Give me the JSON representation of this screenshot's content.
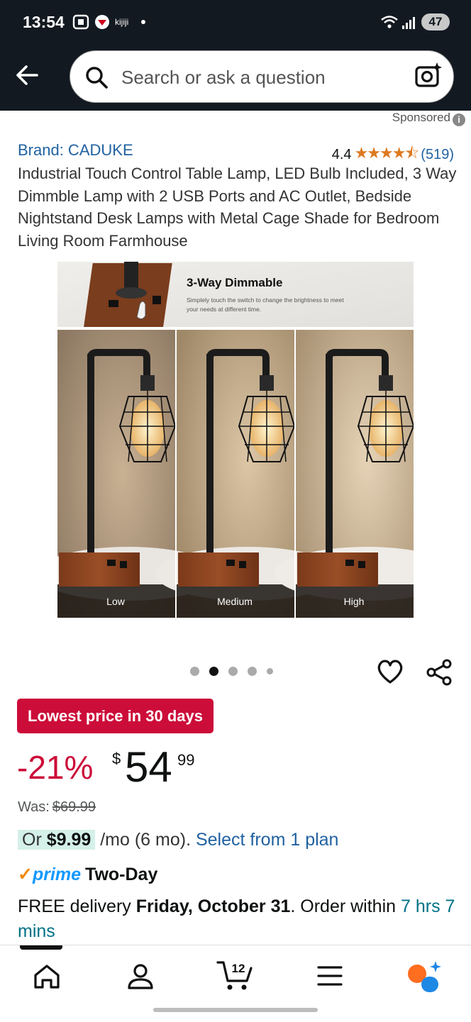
{
  "status": {
    "time": "13:54",
    "app_name": "kijiji",
    "battery": "47"
  },
  "search": {
    "placeholder": "Search or ask a question"
  },
  "sponsored_label": "Sponsored",
  "product": {
    "brand": "Brand: CADUKE",
    "rating_value": "4.4",
    "rating_stars_out_of_5": 4.4,
    "rating_count": "(519)",
    "title": "Industrial Touch Control Table Lamp, LED Bulb Included, 3 Way Dimmble Lamp with 2 USB Ports and AC Outlet, Bedside Nightstand Desk Lamps with Metal Cage Shade for Bedroom Living Room Farmhouse",
    "image": {
      "banner_title": "3-Way Dimmable",
      "banner_subtitle_1": "Simplely touch the switch to change the brightness to meet",
      "banner_subtitle_2": "your needs at different time.",
      "panels": [
        "Low",
        "Medium",
        "High"
      ]
    },
    "carousel": {
      "count": 5,
      "active_index": 1
    }
  },
  "pricing": {
    "deal_badge": "Lowest price in 30 days",
    "discount": "-21%",
    "currency": "$",
    "price_whole": "54",
    "price_fraction": "99",
    "was_label": "Was:",
    "was_price": "$69.99",
    "monthly_prefix": "Or ",
    "monthly_amount": "$9.99",
    "monthly_suffix": " /mo (6 mo). ",
    "plan_link": "Select from 1 plan"
  },
  "delivery": {
    "prime_check": "✓",
    "prime_label": "prime",
    "two_day": "Two-Day",
    "free_text": "FREE delivery ",
    "date": "Friday, October 31",
    "order_within": ". Order within ",
    "countdown": "7 hrs 7 mins"
  },
  "nav": {
    "cart_count": "12"
  },
  "colors": {
    "header_bg": "#131921",
    "deal_red": "#cc0c39",
    "link_blue": "#2162a1",
    "star_orange": "#de7921",
    "teal": "#007185"
  }
}
